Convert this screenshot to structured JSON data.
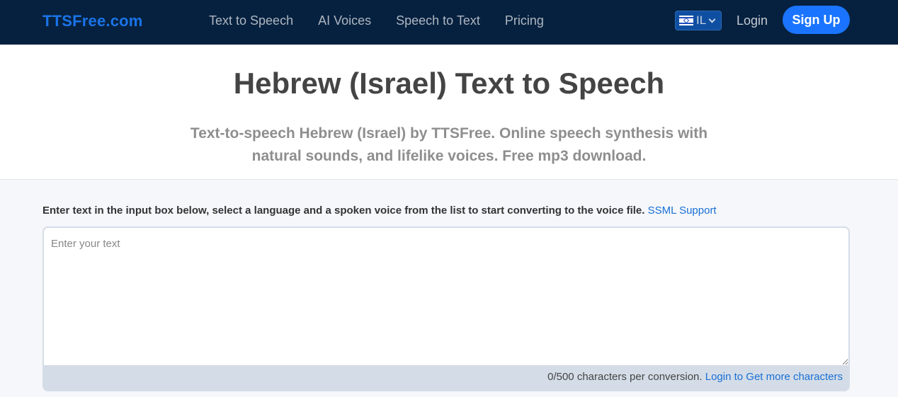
{
  "header": {
    "brand": "TTSFree.com",
    "nav": [
      {
        "label": "Text to Speech"
      },
      {
        "label": "AI Voices"
      },
      {
        "label": "Speech to Text"
      },
      {
        "label": "Pricing"
      }
    ],
    "language": {
      "code": "IL",
      "flag_icon": "israel-flag-icon"
    },
    "login_label": "Login",
    "signup_label": "Sign Up"
  },
  "hero": {
    "title": "Hebrew (Israel) Text to Speech",
    "subtitle_line1": "Text-to-speech Hebrew (Israel) by TTSFree. Online speech synthesis with",
    "subtitle_line2": "natural sounds, and lifelike voices. Free mp3 download."
  },
  "main": {
    "instructions": "Enter text in the input box below, select a language and a spoken voice from the list to start converting to the voice file.",
    "ssml_link": "SSML Support",
    "input": {
      "value": "",
      "placeholder": "Enter your text"
    },
    "counter_text": "0/500 characters per conversion.",
    "more_link": "Login to Get more characters"
  },
  "colors": {
    "navbar_bg": "#06213f",
    "brand": "#1a74e8",
    "accent": "#1a74ff",
    "link": "#1a6fd6"
  }
}
